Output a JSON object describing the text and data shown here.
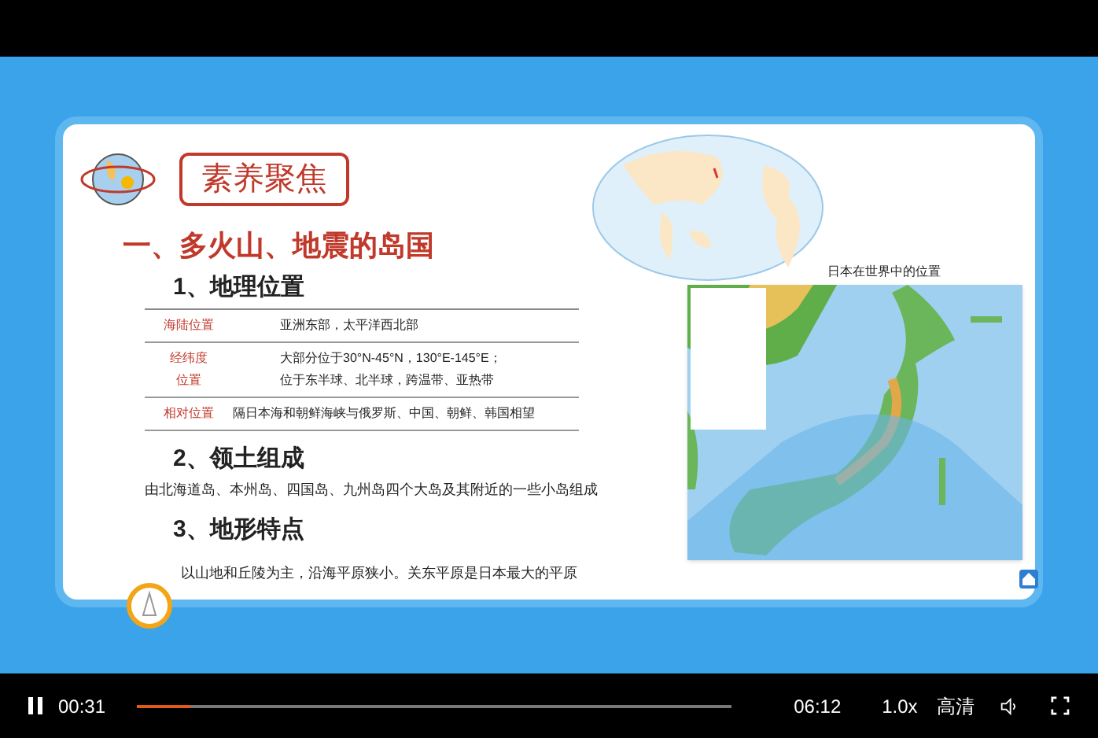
{
  "slide": {
    "badge": "素养聚焦",
    "heading": "一、多火山、地震的岛国",
    "sections": [
      {
        "title": "1、地理位置",
        "kind": "table",
        "groups": [
          {
            "lines": [
              {
                "label": "海陆位置",
                "value": "亚洲东部，太平洋西北部"
              }
            ]
          },
          {
            "lines": [
              {
                "label": "经纬度",
                "value": "大部分位于30°N-45°N，130°E-145°E；"
              },
              {
                "label": "位置",
                "value": "位于东半球、北半球，跨温带、亚热带"
              }
            ]
          },
          {
            "lines": [
              {
                "label": "相对位置",
                "value": "隔日本海和朝鲜海峡与俄罗斯、中国、朝鲜、韩国相望"
              }
            ]
          }
        ]
      },
      {
        "title": "2、领土组成",
        "kind": "text",
        "text": "由北海道岛、本州岛、四国岛、九州岛四个大岛及其附近的一些小岛组成"
      },
      {
        "title": "3、地形特点",
        "kind": "text",
        "text": "以山地和丘陵为主，沿海平原狭小。关东平原是日本最大的平原"
      }
    ],
    "map_caption": "日本在世界中的位置"
  },
  "player": {
    "elapsed": "00:31",
    "progress": {
      "level": 0.09
    },
    "duration": "06:12",
    "speed": "1.0x",
    "quality": "高清",
    "playing": true
  }
}
